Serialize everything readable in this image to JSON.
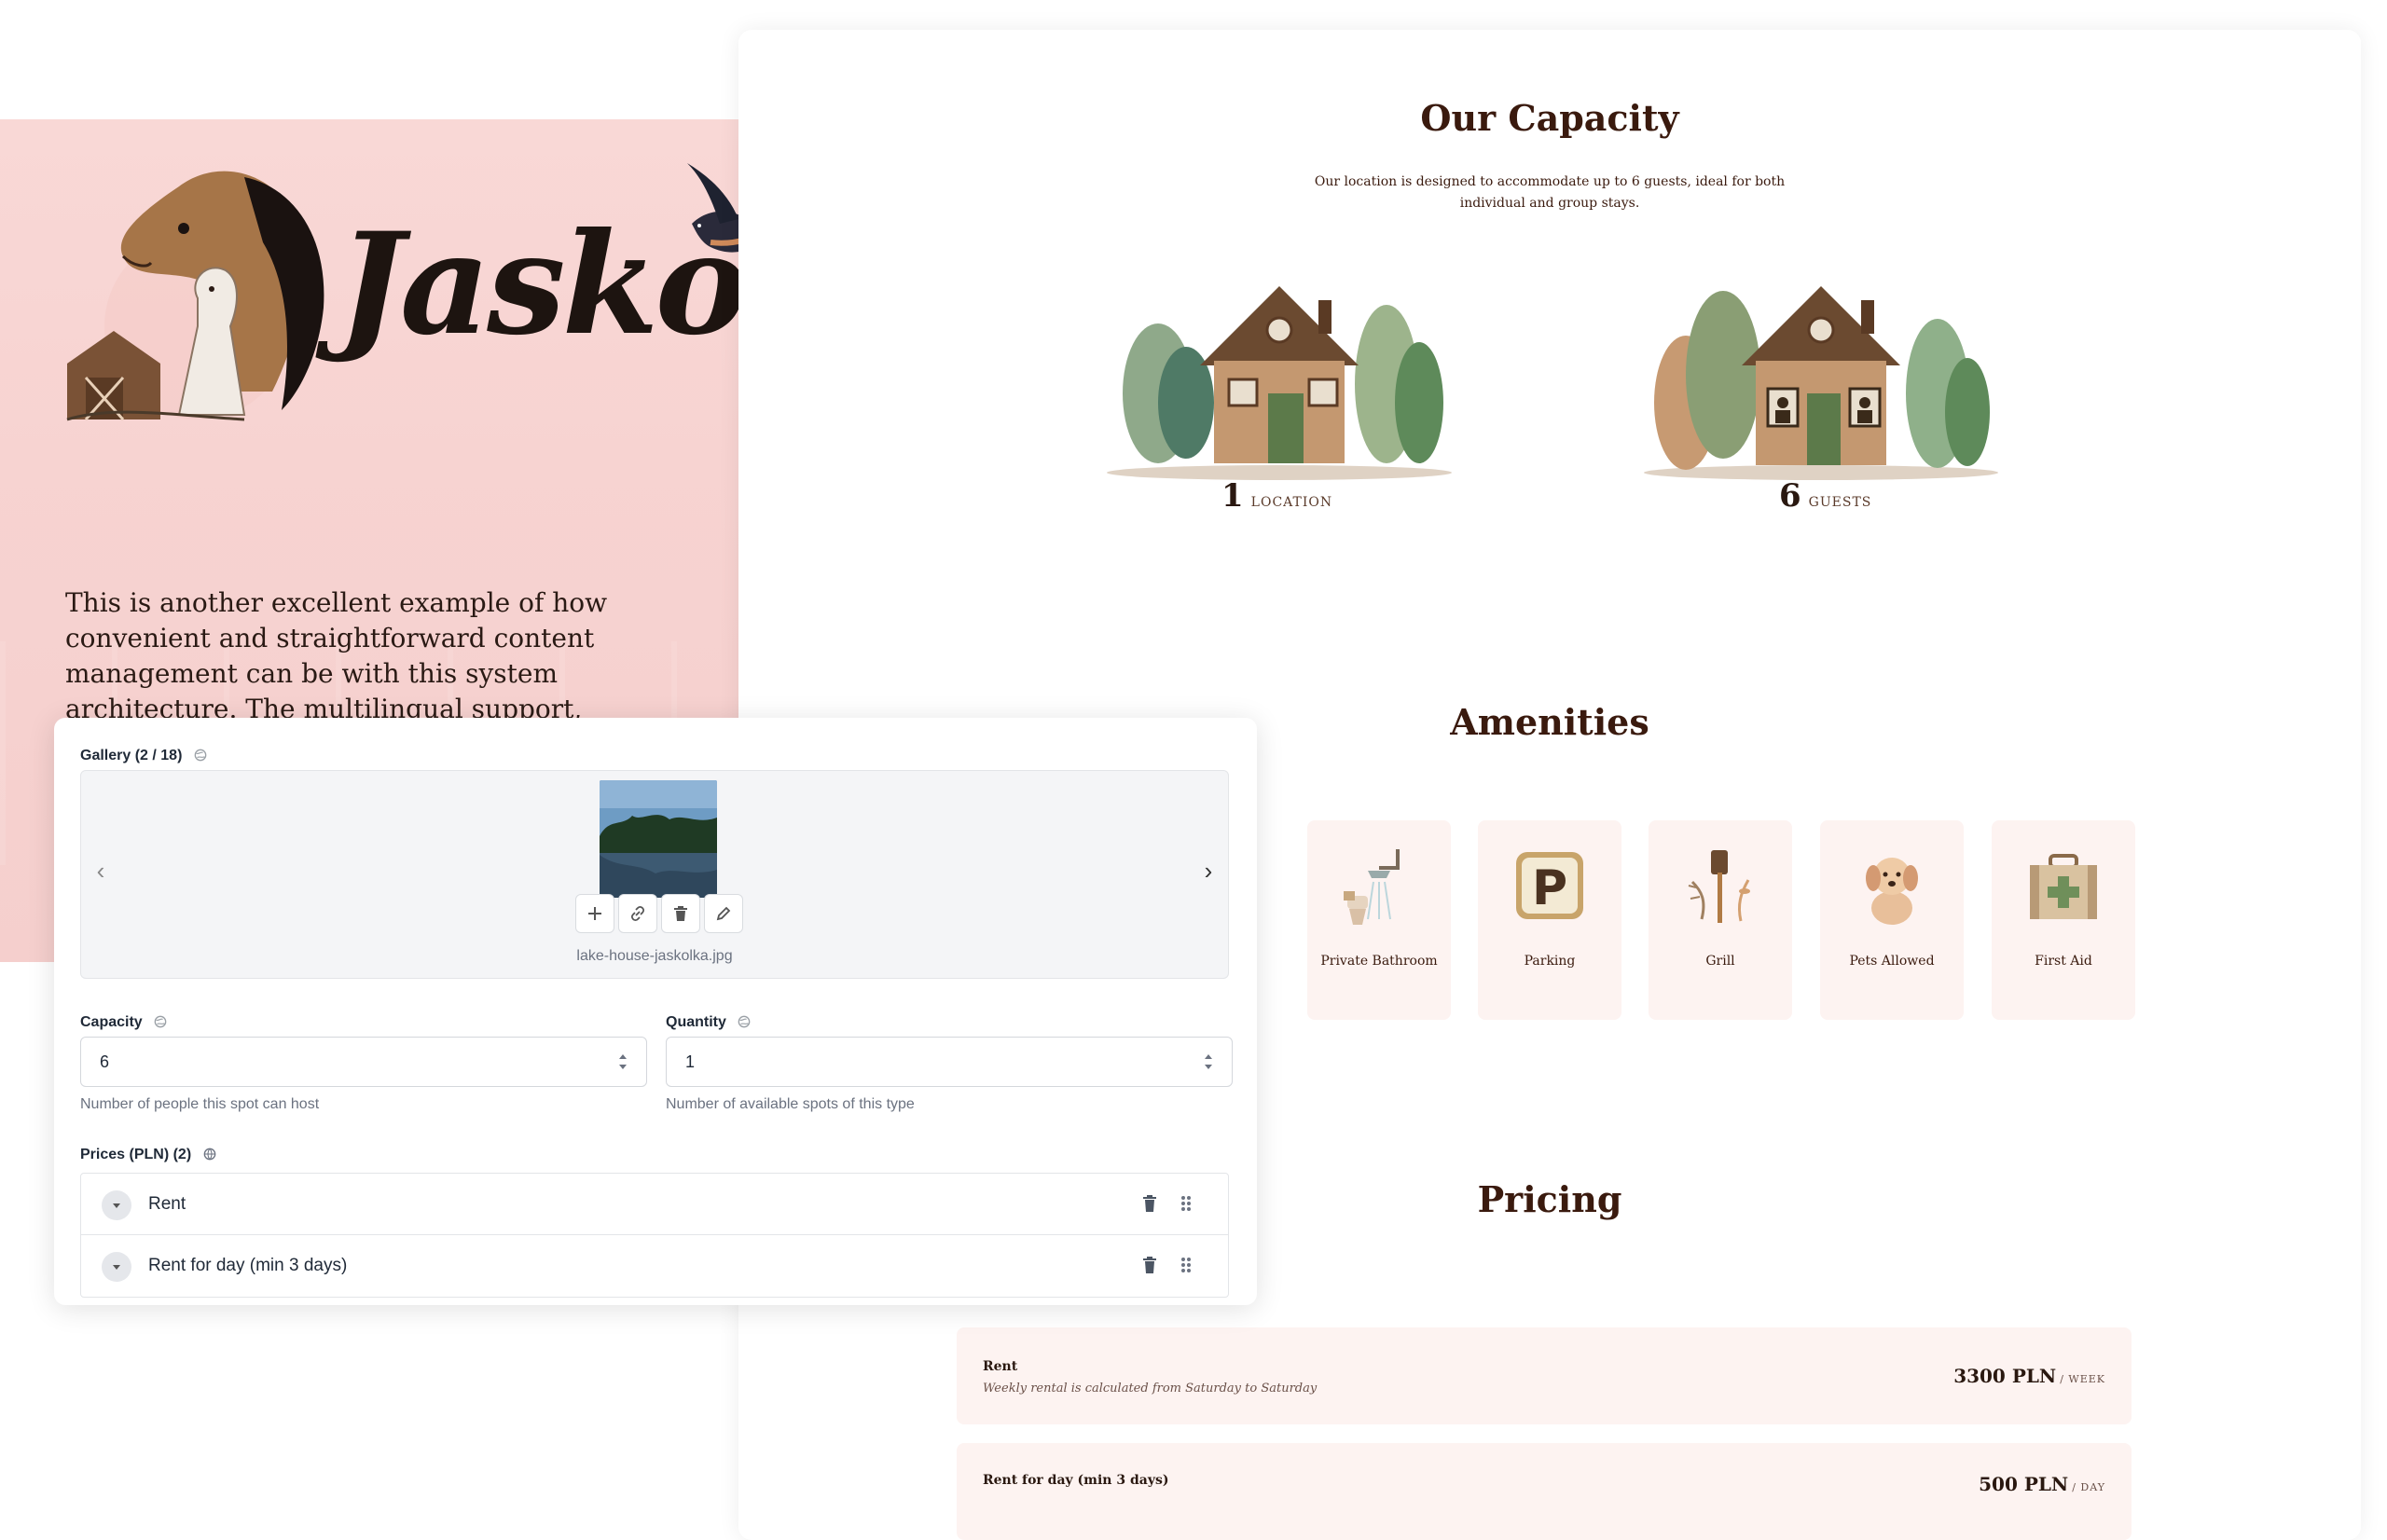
{
  "hero": {
    "logo_text": "Jaskolka",
    "description": "This is another excellent example of how convenient and straightforward content management can be with this system architecture. The multilingual support, developed to meet all requirements, makes site management and information updates easy, even for those who are not IT professionals."
  },
  "capacity": {
    "title": "Our Capacity",
    "subtitle_line1": "Our location is designed to accommodate up to 6 guests, ideal for both",
    "subtitle_line2": "individual and group stays.",
    "stats": [
      {
        "value": "1",
        "unit": "LOCATION"
      },
      {
        "value": "6",
        "unit": "GUESTS"
      }
    ]
  },
  "amenities": {
    "title": "Amenities",
    "items": [
      {
        "label": "Private Bathroom",
        "icon": "shower-toilet-icon"
      },
      {
        "label": "Parking",
        "icon": "parking-sign-icon"
      },
      {
        "label": "Grill",
        "icon": "grill-spatula-icon"
      },
      {
        "label": "Pets Allowed",
        "icon": "puppy-icon"
      },
      {
        "label": "First Aid",
        "icon": "first-aid-kit-icon"
      }
    ]
  },
  "pricing": {
    "title": "Pricing",
    "rows": [
      {
        "name": "Rent",
        "note": "Weekly rental is calculated from Saturday to Saturday",
        "amount": "3300 PLN",
        "per": "/ WEEK"
      },
      {
        "name": "Rent for day (min 3 days)",
        "note": "",
        "amount": "500 PLN",
        "per": "/ DAY"
      }
    ]
  },
  "panel": {
    "gallery_label": "Gallery (2 / 18)",
    "gallery_filename": "lake-house-jaskolka.jpg",
    "capacity_label": "Capacity",
    "capacity_value": "6",
    "capacity_hint": "Number of people this spot can host",
    "quantity_label": "Quantity",
    "quantity_value": "1",
    "quantity_hint": "Number of available spots of this type",
    "prices_label": "Prices (PLN) (2)",
    "price_items": [
      "Rent",
      "Rent for day (min 3 days)"
    ]
  },
  "colors": {
    "hero_bg": "#f7d3d1",
    "title_brown": "#3a1a0e",
    "card_bg": "#fdf3f1"
  }
}
